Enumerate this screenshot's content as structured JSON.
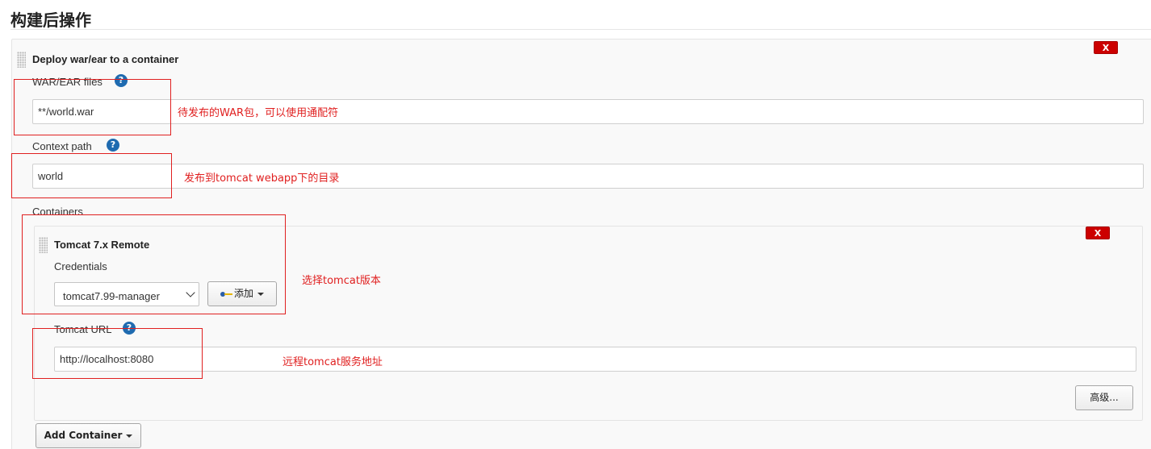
{
  "section": {
    "title": "构建后操作"
  },
  "deploy": {
    "title": "Deploy war/ear to a container",
    "delete_label": "X",
    "war_files": {
      "label": "WAR/EAR files",
      "value": "**/world.war",
      "help": "?"
    },
    "context_path": {
      "label": "Context path",
      "value": "world",
      "help": "?"
    },
    "containers_label": "Containers",
    "add_container_label": "Add Container"
  },
  "container": {
    "title": "Tomcat 7.x Remote",
    "delete_label": "X",
    "credentials": {
      "label": "Credentials",
      "selected": "tomcat7.99-manager",
      "add_label": "添加"
    },
    "tomcat_url": {
      "label": "Tomcat URL",
      "value": "http://localhost:8080",
      "help": "?"
    },
    "advanced_label": "高级..."
  },
  "annotations": {
    "war": "待发布的WAR包，可以使用通配符",
    "context": "发布到tomcat webapp下的目录",
    "container": "选择tomcat版本",
    "url": "远程tomcat服务地址"
  },
  "colors": {
    "annotation": "#e02020",
    "delete": "#cc0000",
    "help": "#1f6bb0"
  }
}
